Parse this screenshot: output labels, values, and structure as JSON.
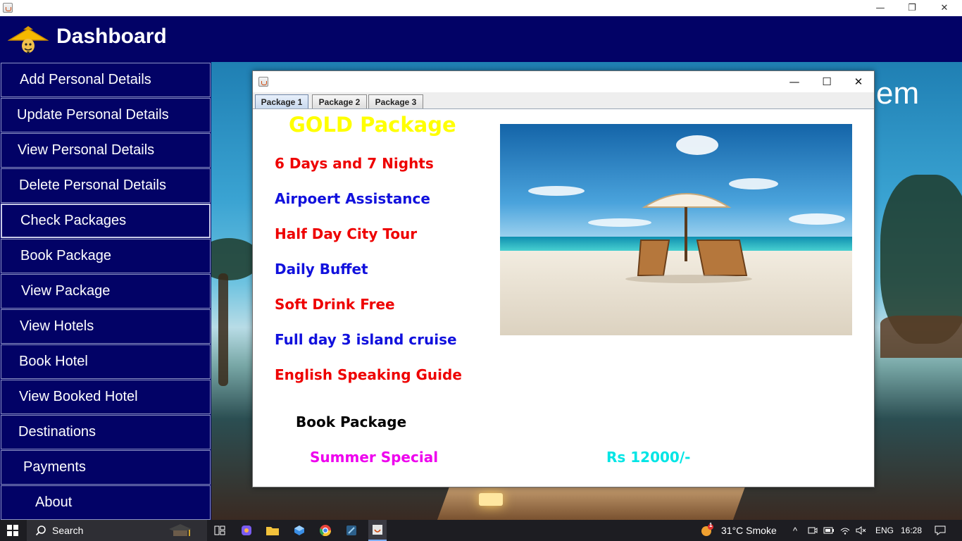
{
  "outer_window": {
    "minimize_glyph": "—",
    "restore_glyph": "❐",
    "close_glyph": "✕"
  },
  "header": {
    "title": "Dashboard"
  },
  "sidebar": {
    "items": [
      {
        "label": "Add Personal Details"
      },
      {
        "label": "Update Personal Details"
      },
      {
        "label": "View Personal Details"
      },
      {
        "label": "Delete Personal Details"
      },
      {
        "label": "Check Packages",
        "active": true
      },
      {
        "label": "Book Package"
      },
      {
        "label": "View Package"
      },
      {
        "label": "View Hotels"
      },
      {
        "label": "Book Hotel"
      },
      {
        "label": "View Booked Hotel"
      },
      {
        "label": "Destinations"
      },
      {
        "label": "Payments"
      },
      {
        "label": "About"
      }
    ]
  },
  "background": {
    "partial_text": "em"
  },
  "package_window": {
    "minimize_glyph": "—",
    "maximize_glyph": "☐",
    "close_glyph": "✕",
    "tabs": [
      {
        "label": "Package 1",
        "selected": true
      },
      {
        "label": "Package 2"
      },
      {
        "label": "Package 3"
      }
    ],
    "title": "GOLD Package",
    "features": [
      {
        "text": "6 Days and 7 Nights",
        "color": "red"
      },
      {
        "text": "Airpoert Assistance",
        "color": "blue"
      },
      {
        "text": "Half Day City Tour",
        "color": "red"
      },
      {
        "text": "Daily Buffet",
        "color": "blue"
      },
      {
        "text": "Soft Drink Free",
        "color": "red"
      },
      {
        "text": "Full day 3 island cruise",
        "color": "blue"
      },
      {
        "text": "English Speaking Guide",
        "color": "red"
      }
    ],
    "book_label": "Book Package",
    "special_label": "Summer Special",
    "price": "Rs 12000/-",
    "colors": {
      "title": "#ffff00",
      "red": "#ee0000",
      "blue": "#1111dd",
      "special": "#ee00ee",
      "price": "#00e5e5"
    }
  },
  "taskbar": {
    "search_label": "Search",
    "weather_badge": "1",
    "weather": "31°C  Smoke",
    "language": "ENG",
    "time": "16:28"
  }
}
